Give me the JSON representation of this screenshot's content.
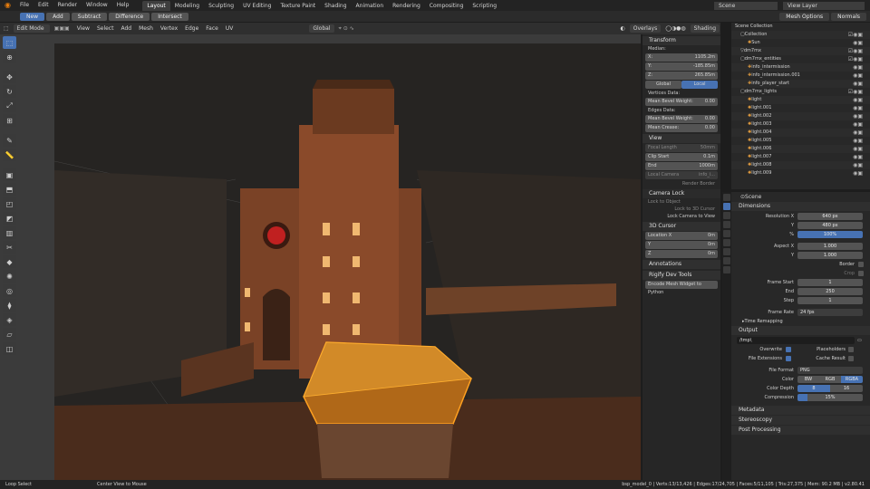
{
  "menu": [
    "File",
    "Edit",
    "Render",
    "Window",
    "Help"
  ],
  "workspaces": [
    {
      "label": "Layout",
      "active": true
    },
    {
      "label": "Modeling"
    },
    {
      "label": "Sculpting"
    },
    {
      "label": "UV Editing"
    },
    {
      "label": "Texture Paint"
    },
    {
      "label": "Shading"
    },
    {
      "label": "Animation"
    },
    {
      "label": "Rendering"
    },
    {
      "label": "Compositing"
    },
    {
      "label": "Scripting"
    }
  ],
  "scene_name": "Scene",
  "view_layer": "View Layer",
  "boolean_tools": [
    {
      "label": "New",
      "active": true
    },
    {
      "label": "Add"
    },
    {
      "label": "Subtract"
    },
    {
      "label": "Difference"
    },
    {
      "label": "Intersect"
    }
  ],
  "mesh_options": "Mesh Options",
  "normals": "Normals",
  "header": {
    "mode": "Edit Mode",
    "menus": [
      "View",
      "Select",
      "Add",
      "Mesh",
      "Vertex",
      "Edge",
      "Face",
      "UV"
    ],
    "orientation": "Global",
    "overlays": "Overlays",
    "shading": "Shading"
  },
  "npanel": {
    "transform_title": "Transform",
    "median_label": "Median:",
    "median": [
      {
        "axis": "X:",
        "value": "1105.2m"
      },
      {
        "axis": "Y:",
        "value": "-185.85m"
      },
      {
        "axis": "Z:",
        "value": "265.85m"
      }
    ],
    "global": "Global",
    "local": "Local",
    "vertices_data": "Vertices Data:",
    "mean_bevel_weight": "Mean Bevel Weight:",
    "mbw_value": "0.00",
    "edges_data": "Edges Data:",
    "mbw2_value": "0.00",
    "mean_crease": "Mean Crease:",
    "crease_value": "0.00",
    "view_title": "View",
    "focal_length": "Focal Length",
    "focal_value": "50mm",
    "clip_start": "Clip Start",
    "clip_start_value": "0.1m",
    "end": "End",
    "end_value": "1000m",
    "local_camera": "Local Camera",
    "local_camera_value": "info_i...",
    "render_border": "Render Border",
    "camera_lock": "Camera Lock",
    "lock_to_object": "Lock to Object",
    "lock_to_cursor": "Lock to 3D Cursor",
    "lock_cam_view": "Lock Camera to View",
    "cursor_title": "3D Cursor",
    "location_x": "Location X",
    "loc_y": "Y",
    "loc_z": "Z",
    "loc_values": [
      "0m",
      "0m",
      "0m"
    ],
    "annotations": "Annotations",
    "rigify": "Rigify Dev Tools",
    "encode": "Encode Mesh Widget to Python"
  },
  "outliner": [
    {
      "name": "Scene Collection",
      "indent": 0
    },
    {
      "name": "Collection",
      "indent": 1
    },
    {
      "name": "Sun",
      "indent": 2
    },
    {
      "name": "dm7mx",
      "indent": 1
    },
    {
      "name": "dm7mx_entities",
      "indent": 1
    },
    {
      "name": "info_intermission",
      "indent": 2
    },
    {
      "name": "info_intermission.001",
      "indent": 2
    },
    {
      "name": "info_player_start",
      "indent": 2
    },
    {
      "name": "dm7mx_lights",
      "indent": 1
    },
    {
      "name": "light",
      "indent": 2
    },
    {
      "name": "light.001",
      "indent": 2
    },
    {
      "name": "light.002",
      "indent": 2
    },
    {
      "name": "light.003",
      "indent": 2
    },
    {
      "name": "light.004",
      "indent": 2
    },
    {
      "name": "light.005",
      "indent": 2
    },
    {
      "name": "light.006",
      "indent": 2
    },
    {
      "name": "light.007",
      "indent": 2
    },
    {
      "name": "light.008",
      "indent": 2
    },
    {
      "name": "light.009",
      "indent": 2
    }
  ],
  "properties": {
    "scene_label": "Scene",
    "dimensions": "Dimensions",
    "res_x_label": "Resolution X",
    "res_x": "640 px",
    "y_label": "Y",
    "res_y": "480 px",
    "pct_label": "%",
    "pct": "100%",
    "aspect_x_label": "Aspect X",
    "aspect_x": "1.000",
    "aspect_y": "1.000",
    "border": "Border",
    "crop": "Crop",
    "frame_start_label": "Frame Start",
    "frame_start": "1",
    "end_label": "End",
    "frame_end": "250",
    "step_label": "Step",
    "step": "1",
    "frame_rate_label": "Frame Rate",
    "frame_rate": "24 fps",
    "time_remap": "Time Remapping",
    "output": "Output",
    "path": "/tmp\\",
    "overwrite": "Overwrite",
    "placeholders": "Placeholders",
    "file_ext": "File Extensions",
    "cache_result": "Cache Result",
    "file_format_label": "File Format",
    "file_format": "PNG",
    "color_label": "Color",
    "color_opts": [
      "BW",
      "RGB",
      "RGBA"
    ],
    "depth_label": "Color Depth",
    "depth_opts": [
      "8",
      "16"
    ],
    "compression_label": "Compression",
    "compression": "15%",
    "metadata": "Metadata",
    "stereoscopy": "Stereoscopy",
    "post": "Post Processing"
  },
  "status": {
    "left": "Loop Select",
    "mid": "Center View to Mouse",
    "stats": "bsp_model_0 | Verts:13/13,426 | Edges:17/24,705 | Faces:5/11,105 | Tris:27,375 | Mem: 90.2 MB | v2.80.41"
  },
  "colors": {
    "accent": "#4772b3",
    "selected": "#e08a14",
    "panel": "#282828"
  }
}
